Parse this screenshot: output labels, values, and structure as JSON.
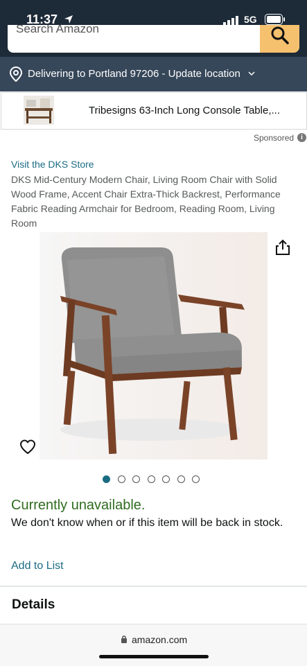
{
  "status_bar": {
    "time": "11:37",
    "network": "5G"
  },
  "search": {
    "placeholder": "Search Amazon"
  },
  "delivery": {
    "text": "Delivering to Portland 97206 - Update location"
  },
  "ad": {
    "title": "Tribesigns 63-Inch Long Console Table,..."
  },
  "sponsored": {
    "label": "Sponsored",
    "info": "i"
  },
  "product": {
    "store_link": "Visit the DKS Store",
    "title": "DKS Mid-Century Modern Chair, Living Room Chair with Solid Wood Frame, Accent Chair Extra-Thick Backrest, Performance Fabric Reading Armchair for Bedroom, Reading Room, Living Room",
    "image_count": 7,
    "active_image_index": 0
  },
  "availability": {
    "status": "Currently unavailable.",
    "description": "We don't know when or if this item will be back in stock."
  },
  "actions": {
    "add_to_list": "Add to List"
  },
  "sections": {
    "details": "Details"
  },
  "browser": {
    "url": "amazon.com"
  },
  "colors": {
    "header_bg": "#1d2a38",
    "delivery_bg": "#37475a",
    "link": "#1b6c83",
    "unavailable": "#2f6c1f",
    "search_button": "#f5c16e"
  }
}
